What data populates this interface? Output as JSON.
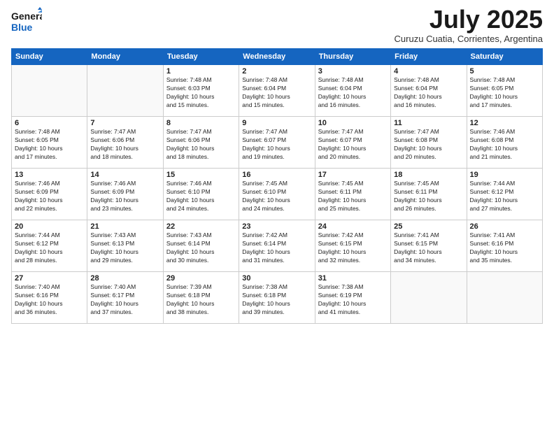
{
  "logo": {
    "line1": "General",
    "line2": "Blue"
  },
  "title": "July 2025",
  "subtitle": "Curuzu Cuatia, Corrientes, Argentina",
  "days_of_week": [
    "Sunday",
    "Monday",
    "Tuesday",
    "Wednesday",
    "Thursday",
    "Friday",
    "Saturday"
  ],
  "weeks": [
    [
      {
        "day": "",
        "info": ""
      },
      {
        "day": "",
        "info": ""
      },
      {
        "day": "1",
        "info": "Sunrise: 7:48 AM\nSunset: 6:03 PM\nDaylight: 10 hours\nand 15 minutes."
      },
      {
        "day": "2",
        "info": "Sunrise: 7:48 AM\nSunset: 6:04 PM\nDaylight: 10 hours\nand 15 minutes."
      },
      {
        "day": "3",
        "info": "Sunrise: 7:48 AM\nSunset: 6:04 PM\nDaylight: 10 hours\nand 16 minutes."
      },
      {
        "day": "4",
        "info": "Sunrise: 7:48 AM\nSunset: 6:04 PM\nDaylight: 10 hours\nand 16 minutes."
      },
      {
        "day": "5",
        "info": "Sunrise: 7:48 AM\nSunset: 6:05 PM\nDaylight: 10 hours\nand 17 minutes."
      }
    ],
    [
      {
        "day": "6",
        "info": "Sunrise: 7:48 AM\nSunset: 6:05 PM\nDaylight: 10 hours\nand 17 minutes."
      },
      {
        "day": "7",
        "info": "Sunrise: 7:47 AM\nSunset: 6:06 PM\nDaylight: 10 hours\nand 18 minutes."
      },
      {
        "day": "8",
        "info": "Sunrise: 7:47 AM\nSunset: 6:06 PM\nDaylight: 10 hours\nand 18 minutes."
      },
      {
        "day": "9",
        "info": "Sunrise: 7:47 AM\nSunset: 6:07 PM\nDaylight: 10 hours\nand 19 minutes."
      },
      {
        "day": "10",
        "info": "Sunrise: 7:47 AM\nSunset: 6:07 PM\nDaylight: 10 hours\nand 20 minutes."
      },
      {
        "day": "11",
        "info": "Sunrise: 7:47 AM\nSunset: 6:08 PM\nDaylight: 10 hours\nand 20 minutes."
      },
      {
        "day": "12",
        "info": "Sunrise: 7:46 AM\nSunset: 6:08 PM\nDaylight: 10 hours\nand 21 minutes."
      }
    ],
    [
      {
        "day": "13",
        "info": "Sunrise: 7:46 AM\nSunset: 6:09 PM\nDaylight: 10 hours\nand 22 minutes."
      },
      {
        "day": "14",
        "info": "Sunrise: 7:46 AM\nSunset: 6:09 PM\nDaylight: 10 hours\nand 23 minutes."
      },
      {
        "day": "15",
        "info": "Sunrise: 7:46 AM\nSunset: 6:10 PM\nDaylight: 10 hours\nand 24 minutes."
      },
      {
        "day": "16",
        "info": "Sunrise: 7:45 AM\nSunset: 6:10 PM\nDaylight: 10 hours\nand 24 minutes."
      },
      {
        "day": "17",
        "info": "Sunrise: 7:45 AM\nSunset: 6:11 PM\nDaylight: 10 hours\nand 25 minutes."
      },
      {
        "day": "18",
        "info": "Sunrise: 7:45 AM\nSunset: 6:11 PM\nDaylight: 10 hours\nand 26 minutes."
      },
      {
        "day": "19",
        "info": "Sunrise: 7:44 AM\nSunset: 6:12 PM\nDaylight: 10 hours\nand 27 minutes."
      }
    ],
    [
      {
        "day": "20",
        "info": "Sunrise: 7:44 AM\nSunset: 6:12 PM\nDaylight: 10 hours\nand 28 minutes."
      },
      {
        "day": "21",
        "info": "Sunrise: 7:43 AM\nSunset: 6:13 PM\nDaylight: 10 hours\nand 29 minutes."
      },
      {
        "day": "22",
        "info": "Sunrise: 7:43 AM\nSunset: 6:14 PM\nDaylight: 10 hours\nand 30 minutes."
      },
      {
        "day": "23",
        "info": "Sunrise: 7:42 AM\nSunset: 6:14 PM\nDaylight: 10 hours\nand 31 minutes."
      },
      {
        "day": "24",
        "info": "Sunrise: 7:42 AM\nSunset: 6:15 PM\nDaylight: 10 hours\nand 32 minutes."
      },
      {
        "day": "25",
        "info": "Sunrise: 7:41 AM\nSunset: 6:15 PM\nDaylight: 10 hours\nand 34 minutes."
      },
      {
        "day": "26",
        "info": "Sunrise: 7:41 AM\nSunset: 6:16 PM\nDaylight: 10 hours\nand 35 minutes."
      }
    ],
    [
      {
        "day": "27",
        "info": "Sunrise: 7:40 AM\nSunset: 6:16 PM\nDaylight: 10 hours\nand 36 minutes."
      },
      {
        "day": "28",
        "info": "Sunrise: 7:40 AM\nSunset: 6:17 PM\nDaylight: 10 hours\nand 37 minutes."
      },
      {
        "day": "29",
        "info": "Sunrise: 7:39 AM\nSunset: 6:18 PM\nDaylight: 10 hours\nand 38 minutes."
      },
      {
        "day": "30",
        "info": "Sunrise: 7:38 AM\nSunset: 6:18 PM\nDaylight: 10 hours\nand 39 minutes."
      },
      {
        "day": "31",
        "info": "Sunrise: 7:38 AM\nSunset: 6:19 PM\nDaylight: 10 hours\nand 41 minutes."
      },
      {
        "day": "",
        "info": ""
      },
      {
        "day": "",
        "info": ""
      }
    ]
  ]
}
